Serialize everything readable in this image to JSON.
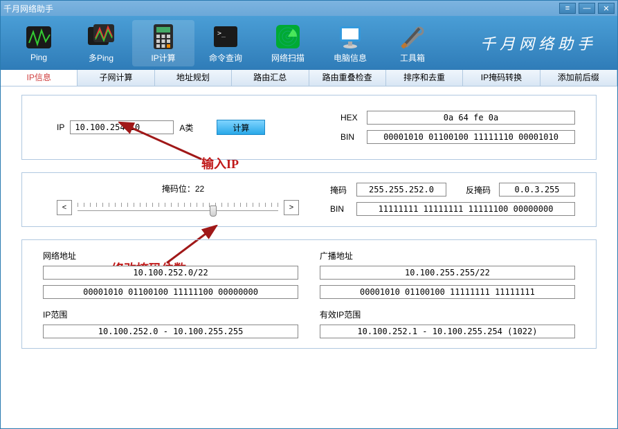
{
  "titlebar": {
    "title": "千月网络助手"
  },
  "toolbar": {
    "items": [
      {
        "label": "Ping"
      },
      {
        "label": "多Ping"
      },
      {
        "label": "IP计算"
      },
      {
        "label": "命令查询"
      },
      {
        "label": "网络扫描"
      },
      {
        "label": "电脑信息"
      },
      {
        "label": "工具箱"
      }
    ],
    "brand": "千月网络助手"
  },
  "tabs": [
    "IP信息",
    "子网计算",
    "地址规划",
    "路由汇总",
    "路由重叠检查",
    "排序和去重",
    "IP掩码转换",
    "添加前后缀"
  ],
  "panel1": {
    "ip_label": "IP",
    "ip_value": "10.100.254.10",
    "ip_class": "A类",
    "calc_btn": "计算",
    "hex_label": "HEX",
    "hex_value": "0a 64 fe 0a",
    "bin_label": "BIN",
    "bin_value": "00001010 01100100 11111110 00001010"
  },
  "annot1": "输入IP",
  "panel2": {
    "maskbits_label": "掩码位：",
    "maskbits_value": "22",
    "mask_label": "掩码",
    "mask_value": "255.255.252.0",
    "wildcard_label": "反掩码",
    "wildcard_value": "0.0.3.255",
    "bin_label": "BIN",
    "bin_value": "11111111 11111111 11111100 00000000"
  },
  "annot2": "修改掩码位数",
  "panel3": {
    "network_label": "网络地址",
    "network_cidr": "10.100.252.0/22",
    "network_bin": "00001010 01100100 11111100 00000000",
    "broadcast_label": "广播地址",
    "broadcast_cidr": "10.100.255.255/22",
    "broadcast_bin": "00001010 01100100 11111111 11111111",
    "iprange_label": "IP范围",
    "iprange_value": "10.100.252.0 - 10.100.255.255",
    "validrange_label": "有效IP范围",
    "validrange_value": "10.100.252.1 - 10.100.255.254 (1022)"
  }
}
